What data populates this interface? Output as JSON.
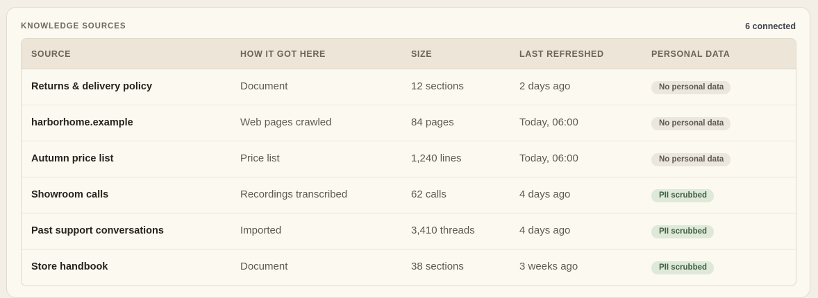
{
  "panel": {
    "title": "KNOWLEDGE SOURCES",
    "count": "6 connected"
  },
  "table": {
    "headers": [
      "SOURCE",
      "HOW IT GOT HERE",
      "SIZE",
      "LAST REFRESHED",
      "PERSONAL DATA"
    ],
    "rows": [
      {
        "source": "Returns & delivery policy",
        "how": "Document",
        "size": "12 sections",
        "refreshed": "2 days ago",
        "personal": "No personal data",
        "personal_kind": "none"
      },
      {
        "source": "harborhome.example",
        "how": "Web pages crawled",
        "size": "84 pages",
        "refreshed": "Today, 06:00",
        "personal": "No personal data",
        "personal_kind": "none"
      },
      {
        "source": "Autumn price list",
        "how": "Price list",
        "size": "1,240 lines",
        "refreshed": "Today, 06:00",
        "personal": "No personal data",
        "personal_kind": "none"
      },
      {
        "source": "Showroom calls",
        "how": "Recordings transcribed",
        "size": "62 calls",
        "refreshed": "4 days ago",
        "personal": "PII scrubbed",
        "personal_kind": "pii"
      },
      {
        "source": "Past support conversations",
        "how": "Imported",
        "size": "3,410 threads",
        "refreshed": "4 days ago",
        "personal": "PII scrubbed",
        "personal_kind": "pii"
      },
      {
        "source": "Store handbook",
        "how": "Document",
        "size": "38 sections",
        "refreshed": "3 weeks ago",
        "personal": "PII scrubbed",
        "personal_kind": "pii"
      }
    ]
  }
}
